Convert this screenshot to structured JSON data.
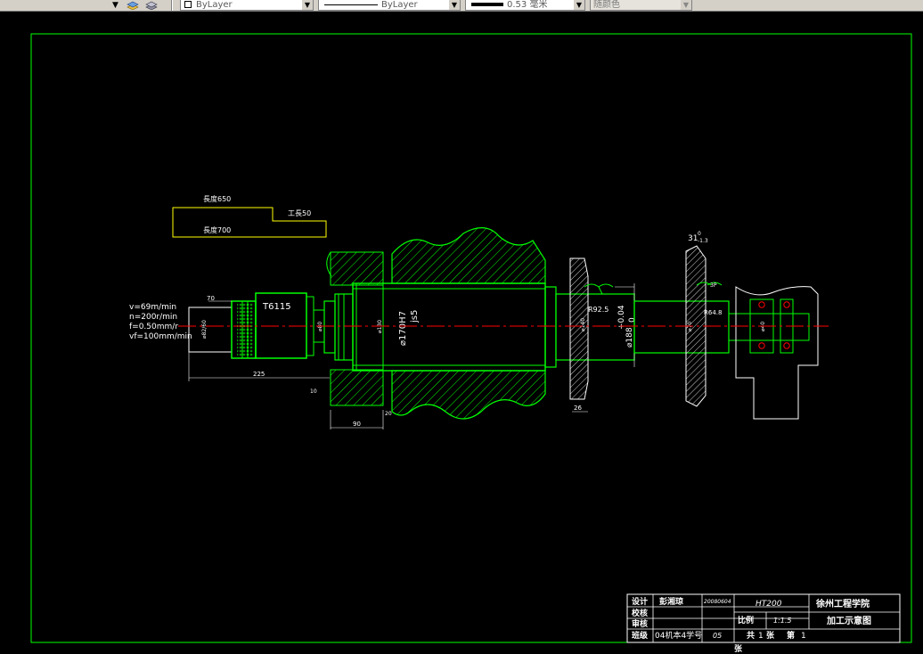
{
  "toolbar": {
    "layer_combo": {
      "icons": [
        "layer-state-icon",
        "layer-stack-icon"
      ]
    },
    "color_combo": {
      "value": "ByLayer"
    },
    "linetype_combo": {
      "value": "ByLayer"
    },
    "lineweight_combo": {
      "value": "0.53 毫米"
    },
    "plotstyle_combo": {
      "value": "随颜色"
    }
  },
  "colors": {
    "background": "#000000",
    "frame": "#00ff00",
    "part": "#00ff00",
    "dimension": "#ffffff",
    "centerline": "#ff0000",
    "fixture_block": "#ffff00",
    "bearing": "#ff0000"
  },
  "drawing": {
    "fixture_block": {
      "label_top": "長度650",
      "label_mid": "工長50",
      "label_bottom": "長度700"
    },
    "cutting_params": [
      "v=69m/min",
      "n=200r/min",
      "f=0.50mm/r",
      "vf=100mm/min"
    ],
    "tool_label": "T6115",
    "dims": {
      "tool_length_top": "70",
      "tool_dia": "⌀82/60",
      "tool_total": "225",
      "small_offset": "10",
      "sleeve_dia": "⌀80",
      "inner_dia": "⌀130",
      "bore_fit_1": "⌀170H7",
      "bore_fit_2": "js5",
      "width_90": "90",
      "small_20": "20",
      "spindle_dia": "⌀140",
      "radius_r": "R92.5",
      "outer_dia": "⌀188",
      "tol_upper": "+0.04",
      "tol_lower": "0",
      "width_26": "26",
      "pulley_width": "31",
      "pulley_tol_up": "0",
      "pulley_tol_low": "-1.3",
      "dim_3p": "3P",
      "radius_r2": "R64.8",
      "shaft_dia": "⌀70",
      "end_dia": "⌀40"
    }
  },
  "title_block": {
    "row_design_label": "设计",
    "designer_name": "彭湘琼",
    "design_date": "20080604",
    "row_check_label": "校核",
    "row_review_label": "审核",
    "row_class_label": "班级",
    "class_value": "04机本4学号",
    "student_no": "05",
    "material": "HT200",
    "school": "徐州工程学院",
    "scale_label": "比例",
    "scale_value": "1:1.5",
    "drawing_title": "加工示意图",
    "sheet_total_prefix": "共",
    "sheet_total": "1",
    "sheet_unit": "张",
    "sheet_no_prefix": "第",
    "sheet_no": "1",
    "sheet_unit_2": "张"
  }
}
